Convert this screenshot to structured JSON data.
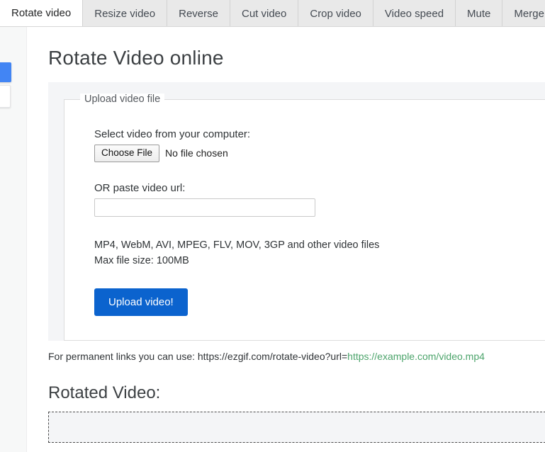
{
  "tabs": [
    {
      "label": "Rotate video",
      "active": true
    },
    {
      "label": "Resize video",
      "active": false
    },
    {
      "label": "Reverse",
      "active": false
    },
    {
      "label": "Cut video",
      "active": false
    },
    {
      "label": "Crop video",
      "active": false
    },
    {
      "label": "Video speed",
      "active": false
    },
    {
      "label": "Mute",
      "active": false
    },
    {
      "label": "Merge video",
      "active": false
    }
  ],
  "page": {
    "title": "Rotate Video online"
  },
  "upload": {
    "legend": "Upload video file",
    "select_label": "Select video from your computer:",
    "choose_file_button": "Choose File",
    "no_file_text": "No file chosen",
    "url_label": "OR paste video url:",
    "url_value": "",
    "url_placeholder": "",
    "formats": "MP4, WebM, AVI, MPEG, FLV, MOV, 3GP and other video files",
    "max_size": "Max file size: 100MB",
    "submit_button": "Upload video!"
  },
  "permalink": {
    "prefix": "For permanent links you can use: https://ezgif.com/rotate-video?url=",
    "url": "https://example.com/video.mp4"
  },
  "result": {
    "title": "Rotated Video:"
  },
  "colors": {
    "accent_blue": "#0b63ce",
    "sidebar_blue": "#4285f4",
    "link_green": "#4ca46b",
    "panel_grey": "#f4f5f7"
  }
}
